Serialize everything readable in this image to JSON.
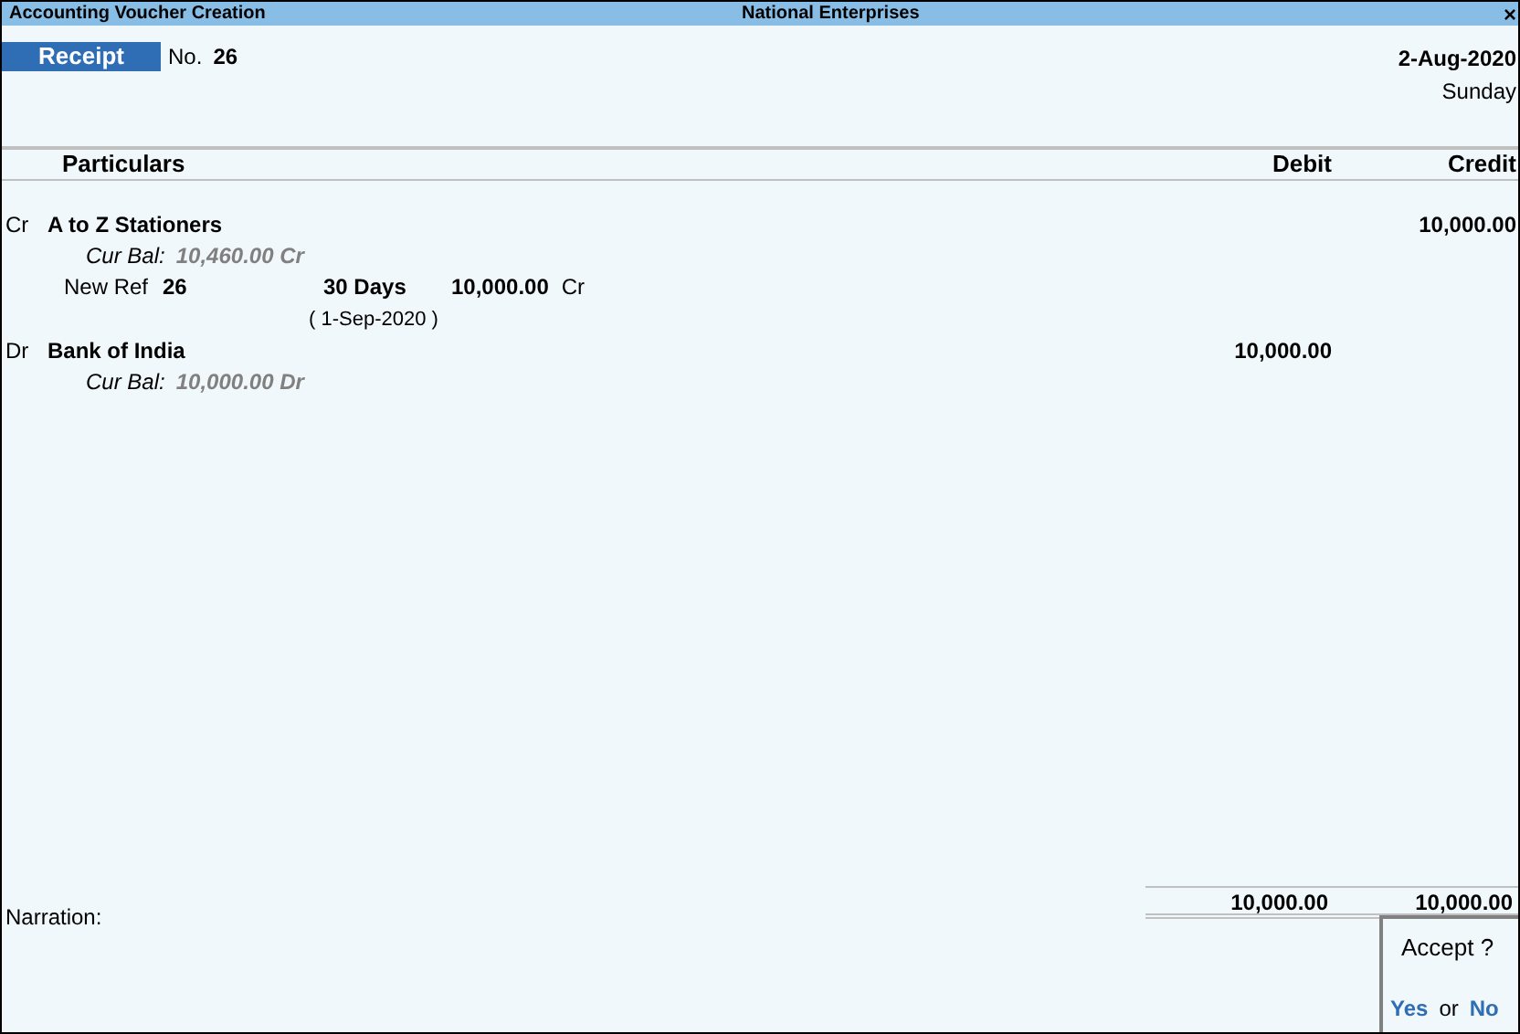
{
  "window": {
    "title": "Accounting Voucher Creation",
    "company": "National Enterprises",
    "close": "×"
  },
  "voucher": {
    "type": "Receipt",
    "number_label": "No.",
    "number": "26",
    "date": "2-Aug-2020",
    "day": "Sunday"
  },
  "columns": {
    "particulars": "Particulars",
    "debit": "Debit",
    "credit": "Credit"
  },
  "entries": [
    {
      "side": "Cr",
      "ledger": "A to Z Stationers",
      "credit": "10,000.00",
      "balance_label": "Cur Bal:",
      "balance": "10,460.00 Cr",
      "bills": [
        {
          "type": "New Ref",
          "name": "26",
          "due": "30 Days",
          "amount": "10,000.00",
          "side": "Cr",
          "due_date": "( 1-Sep-2020 )"
        }
      ]
    },
    {
      "side": "Dr",
      "ledger": "Bank of India",
      "debit": "10,000.00",
      "balance_label": "Cur Bal:",
      "balance": "10,000.00 Dr"
    }
  ],
  "narration": {
    "label": "Narration:"
  },
  "totals": {
    "debit": "10,000.00",
    "credit": "10,000.00"
  },
  "dialog": {
    "question": "Accept ?",
    "yes": "Yes",
    "or": "or",
    "no": "No"
  }
}
